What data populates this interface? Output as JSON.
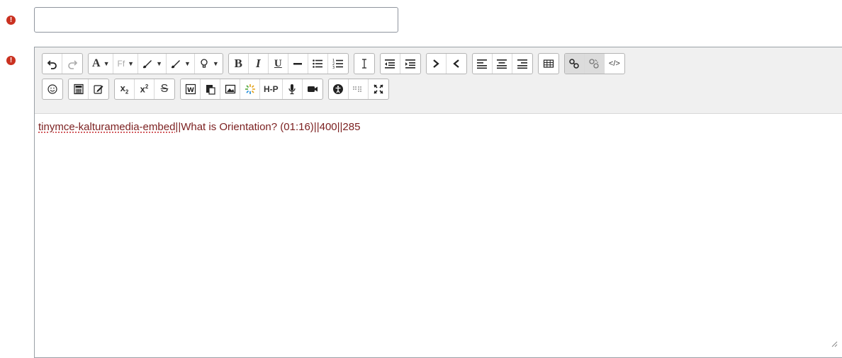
{
  "required_icon": "!",
  "title_field": {
    "value": ""
  },
  "editor": {
    "content_spell": "tinymce-kalturamedia-embed",
    "content_rest": "||What is Orientation? (01:16)||400||285",
    "font_family_label": "Ff"
  },
  "colors": {
    "required": "#ca3120",
    "content_text": "#7b1f1f"
  },
  "toolbar_icons_row1": [
    "undo-icon",
    "redo-icon",
    "font-size-icon",
    "font-family-icon",
    "text-color-icon",
    "background-color-icon",
    "lightbulb-icon",
    "bold-icon",
    "italic-icon",
    "underline-icon",
    "horizontal-rule-icon",
    "bullet-list-icon",
    "numbered-list-icon",
    "text-cursor-icon",
    "outdent-icon",
    "indent-icon",
    "ltr-icon",
    "rtl-icon",
    "align-left-icon",
    "align-center-icon",
    "align-right-icon",
    "table-icon",
    "link-icon",
    "unlink-icon",
    "html-code-icon"
  ],
  "toolbar_icons_row2": [
    "emoji-icon",
    "calculator-icon",
    "edit-icon",
    "subscript-icon",
    "superscript-icon",
    "strikethrough-icon",
    "paste-word-icon",
    "paste-text-icon",
    "image-icon",
    "loading-icon",
    "h5p-icon",
    "microphone-icon",
    "video-icon",
    "accessibility-icon",
    "screenreader-icon",
    "fullscreen-icon"
  ]
}
